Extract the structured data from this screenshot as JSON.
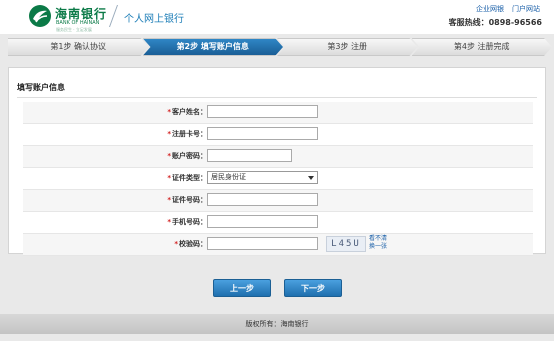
{
  "header": {
    "bank_name_cn": "海南银行",
    "bank_name_en": "BANK OF HAINAN",
    "bank_slogan": "服务民生 · 立足发展",
    "system_title": "个人网上银行",
    "links": [
      "企业网银",
      "门户网站"
    ],
    "hotline": "客服热线：0898-96566"
  },
  "steps": [
    {
      "label": "第1步 确认协议",
      "active": false
    },
    {
      "label": "第2步 填写账户信息",
      "active": true
    },
    {
      "label": "第3步 注册",
      "active": false
    },
    {
      "label": "第4步 注册完成",
      "active": false
    }
  ],
  "panel": {
    "title": "填写账户信息"
  },
  "form": {
    "required_mark": "*",
    "fields": [
      {
        "label": "客户姓名：",
        "value": "",
        "type": "text"
      },
      {
        "label": "注册卡号：",
        "value": "",
        "type": "text"
      },
      {
        "label": "账户密码：",
        "value": "",
        "type": "password"
      },
      {
        "label": "证件类型：",
        "value": "居民身份证",
        "type": "select"
      },
      {
        "label": "证件号码：",
        "value": "",
        "type": "text"
      },
      {
        "label": "手机号码：",
        "value": "",
        "type": "text"
      },
      {
        "label": "校验码：",
        "value": "",
        "type": "captcha"
      }
    ],
    "captcha_text": "L45U",
    "captcha_refresh": "看不清换一张"
  },
  "buttons": {
    "prev": "上一步",
    "next": "下一步"
  },
  "footer": {
    "copyright": "版权所有：海南银行"
  },
  "colors": {
    "brand_green": "#0b7a47",
    "active_step_blue": "#1a5e96",
    "button_blue": "#2f86c5",
    "required_red": "#d21f1f"
  }
}
